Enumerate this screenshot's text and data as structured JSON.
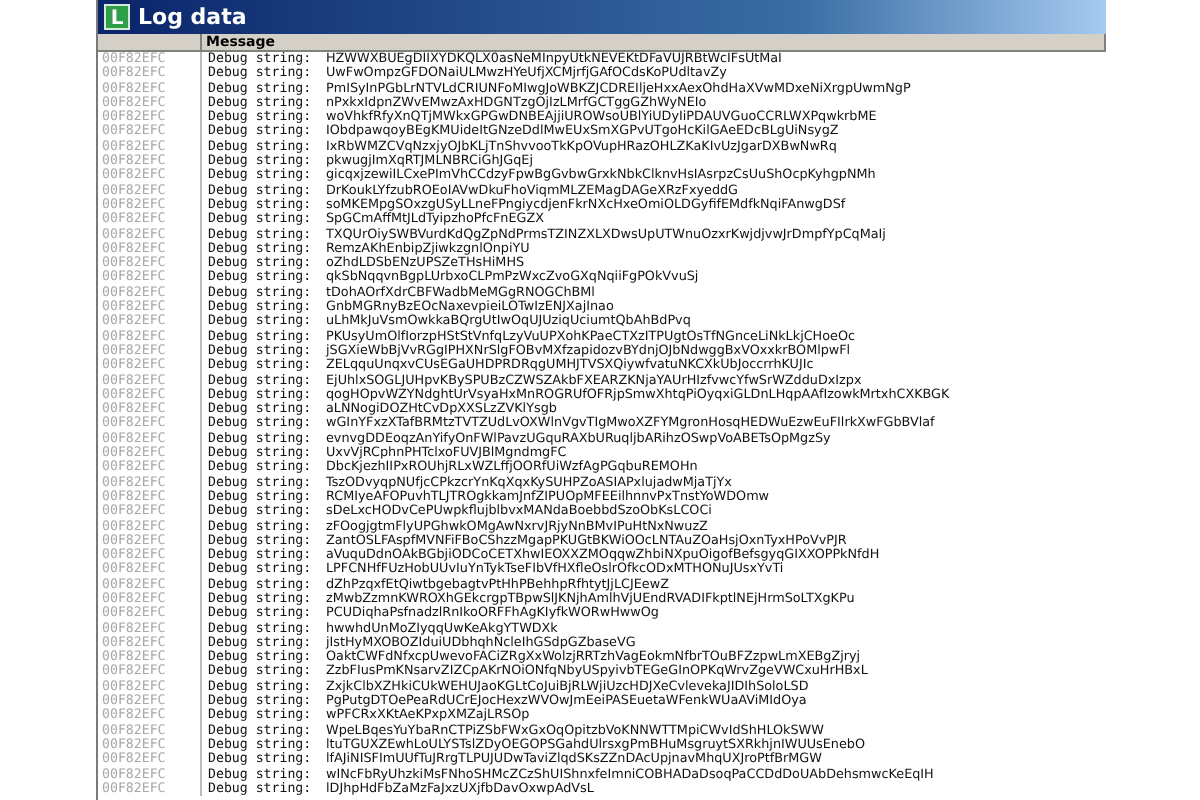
{
  "window": {
    "title": "Log data",
    "icon_letter": "L"
  },
  "columns": [
    "Message"
  ],
  "rows": [
    {
      "address": "00F82EFC",
      "type": "Debug string:",
      "message": "HZWWXBUEgDIIXYDKQLX0asNeMInpyUtkNEVEKtDFaVUJRBtWcIFsUtMaI"
    },
    {
      "address": "00F82EFC",
      "type": "Debug string:",
      "message": "UwFwOmpzGFDONaiULMwzHYeUfjXCMjrfjGAfOCdsKoPUdltavZy"
    },
    {
      "address": "00F82EFC",
      "type": "Debug string:",
      "message": "PmISyInPGbLrNTVLdCRIUNFoMIwgJoWBKZJCDREIljeHxxAexOhdHaXVwMDxeNiXrgpUwmNgP"
    },
    {
      "address": "00F82EFC",
      "type": "Debug string:",
      "message": "nPxkxIdpnZWvEMwzAxHDGNTzgOjIzLMrfGCTggGZhWyNEIo"
    },
    {
      "address": "00F82EFC",
      "type": "Debug string:",
      "message": "woVhkfRfyXnQTjMWkxGPGwDNBEAjjiUROWsoUBlYiUDyIiPDAUVGuoCCRLWXPqwkrbME"
    },
    {
      "address": "00F82EFC",
      "type": "Debug string:",
      "message": "IObdpawqoyBEgKMUideItGNzeDdlMwEUxSmXGPvUTgoHcKilGAeEDcBLgUiNsygZ"
    },
    {
      "address": "00F82EFC",
      "type": "Debug string:",
      "message": "IxRbWMZCVqNzxjyOJbKLjTnShvvooTkKpOVupHRazOHLZKaKIvUzJgarDXBwNwRq"
    },
    {
      "address": "00F82EFC",
      "type": "Debug string:",
      "message": "pkwugjImXqRTJMLNBRCiGhJGqEj"
    },
    {
      "address": "00F82EFC",
      "type": "Debug string:",
      "message": "gicqxjzewiILCxePImVhCCdzyFpwBgGvbwGrxkNbkClknvHsIAsrpzCsUuShOcpKyhgpNMh"
    },
    {
      "address": "00F82EFC",
      "type": "Debug string:",
      "message": "DrKoukLYfzubROEoIAVwDkuFhoViqmMLZEMagDAGeXRzFxyeddG"
    },
    {
      "address": "00F82EFC",
      "type": "Debug string:",
      "message": "soMKEMpgSOxzgUSyLLneFPngiycdjenFkrNXcHxeOmiOLDGyfifEMdfkNqiFAnwgDSf"
    },
    {
      "address": "00F82EFC",
      "type": "Debug string:",
      "message": "SpGCmAffMtJLdTyipzhoPfcFnEGZX"
    },
    {
      "address": "00F82EFC",
      "type": "Debug string:",
      "message": "TXQUrOiySWBVurdKdQgZpNdPrmsTZINZXLXDwsUpUTWnuOzxrKwjdjvwJrDmpfYpCqMaIj"
    },
    {
      "address": "00F82EFC",
      "type": "Debug string:",
      "message": "RemzAKhEnbipZjiwkzgnlOnpiYU"
    },
    {
      "address": "00F82EFC",
      "type": "Debug string:",
      "message": "oZhdLDSbENzUPSZeTHsHiMHS"
    },
    {
      "address": "00F82EFC",
      "type": "Debug string:",
      "message": "qkSbNqqvnBgpLUrbxoCLPmPzWxcZvoGXqNqiiFgPOkVvuSj"
    },
    {
      "address": "00F82EFC",
      "type": "Debug string:",
      "message": "tDohAOrfXdrCBFWadbMeMGgRNOGChBMl"
    },
    {
      "address": "00F82EFC",
      "type": "Debug string:",
      "message": "GnbMGRnyBzEOcNaxevpieiLOTwIzENJXajInao"
    },
    {
      "address": "00F82EFC",
      "type": "Debug string:",
      "message": "uLhMkJuVsmOwkkaBQrgUtIwOqUJUziqUciumtQbAhBdPvq"
    },
    {
      "address": "00F82EFC",
      "type": "Debug string:",
      "message": "PKUsyUmOlfIorzpHStStVnfqLzyVuUPXohKPaeCTXzITPUgtOsTfNGnceLiNkLkjCHoeOc"
    },
    {
      "address": "00F82EFC",
      "type": "Debug string:",
      "message": "jSGXieWbBjVvRGgIPHXNrSlgFOBvMXfzapidozvBYdnjOJbNdwggBxVOxxkrBOMlpwFl"
    },
    {
      "address": "00F82EFC",
      "type": "Debug string:",
      "message": "ZELqquUnqxvCUsEGaUHDPRDRqgUMHJTVSXQiywfvatuNKCXkUbJoccrrhKUJIc"
    },
    {
      "address": "00F82EFC",
      "type": "Debug string:",
      "message": "EjUhlxSOGLJUHpvKBySPUBzCZWSZAkbFXEARZKNjaYAUrHIzfvwcYfwSrWZdduDxIzpx"
    },
    {
      "address": "00F82EFC",
      "type": "Debug string:",
      "message": "qogHOpvWZYNdghtUrVsyaHxMnROGRUfOFRjpSmwXhtqPiOyqxiGLDnLHqpAAfIzowkMrtxhCXKBGK"
    },
    {
      "address": "00F82EFC",
      "type": "Debug string:",
      "message": "aLNNogiDOZHtCvDpXXSLzZVKlYsgb"
    },
    {
      "address": "00F82EFC",
      "type": "Debug string:",
      "message": "wGInYFxzXTafBRMtzTVTZUdLvOXWlnVgvTIgMwoXZFYMgronHosqHEDWuEzwEuFIlrkXwFGbBVlaf"
    },
    {
      "address": "00F82EFC",
      "type": "Debug string:",
      "message": "evnvgDDEoqzAnYifyOnFWlPavzUGquRAXbURuqljbARihzOSwpVoABETsOpMgzSy"
    },
    {
      "address": "00F82EFC",
      "type": "Debug string:",
      "message": "UxvVjRCphnPHTclxoFUVJBlMgndmgFC"
    },
    {
      "address": "00F82EFC",
      "type": "Debug string:",
      "message": "DbcKjezhIIPxROUhjRLxWZLffjOORfUiWzfAgPGqbuREMOHn"
    },
    {
      "address": "00F82EFC",
      "type": "Debug string:",
      "message": "TszODvyqpNUfjcCPkzcrYnKqXqxKySUHPZoASIAPxlujadwMjaTjYx"
    },
    {
      "address": "00F82EFC",
      "type": "Debug string:",
      "message": "RCMIyeAFOPuvhTLJTROgkkamJnfZIPUOpMFEEilhnnvPxTnstYoWDOmw"
    },
    {
      "address": "00F82EFC",
      "type": "Debug string:",
      "message": "sDeLxcHODvCePUwpkflujblbvxMANdaBoebbdSzoObKsLCOCi"
    },
    {
      "address": "00F82EFC",
      "type": "Debug string:",
      "message": "zFOogjgtmFlyUPGhwkOMgAwNxrvJRjyNnBMvIPuHtNxNwuzZ"
    },
    {
      "address": "00F82EFC",
      "type": "Debug string:",
      "message": "ZantOSLFAspfMVNFiFBoCShzzMgapPKUGtBKWiOOcLNTAuZOaHsjOxnTyxHPoVvPJR"
    },
    {
      "address": "00F82EFC",
      "type": "Debug string:",
      "message": "aVuquDdnOAkBGbjiODCoCETXhwIEOXXZMOqqwZhbiNXpuOigofBefsgyqGIXXOPPkNfdH"
    },
    {
      "address": "00F82EFC",
      "type": "Debug string:",
      "message": "LPFCNHfFUzHobUUvIuYnTykTseFIbVfHXfleOslrOfkcODxMTHONuJUsxYvTi"
    },
    {
      "address": "00F82EFC",
      "type": "Debug string:",
      "message": "dZhPzqxfEtQiwtbgebagtvPtHhPBehhpRfhtytJjLCJEewZ"
    },
    {
      "address": "00F82EFC",
      "type": "Debug string:",
      "message": "zMwbZzmnKWROXhGEkcrgpTBpwSlJKNjhAmlhVjUEndRVADIFkptlNEjHrmSoLTXgKPu"
    },
    {
      "address": "00F82EFC",
      "type": "Debug string:",
      "message": "PCUDiqhaPsfnadzlRnIkoORFFhAgKIyfkWORwHwwOg"
    },
    {
      "address": "00F82EFC",
      "type": "Debug string:",
      "message": "hwwhdUnMoZIyqqUwKeAkgYTWDXk"
    },
    {
      "address": "00F82EFC",
      "type": "Debug string:",
      "message": "jIstHyMXOBOZIduiUDbhqhNcleIhGSdpGZbaseVG"
    },
    {
      "address": "00F82EFC",
      "type": "Debug string:",
      "message": "OaktCWFdNfxcpUwevoFACiZRgXxWolzjRRTzhVagEokmNfbrTOuBFZzpwLmXEBgZjryj"
    },
    {
      "address": "00F82EFC",
      "type": "Debug string:",
      "message": "ZzbFIusPmKNsarvZIZCpAKrNOiONfqNbyUSpyivbTEGeGInOPKqWrvZgeVWCxuHrHBxL"
    },
    {
      "address": "00F82EFC",
      "type": "Debug string:",
      "message": "ZxjkClbXZHkiCUkWEHUJaoKGLtCoJuiBjRLWjiUzcHDJXeCvlevekaJIDIhSoloLSD"
    },
    {
      "address": "00F82EFC",
      "type": "Debug string:",
      "message": "PgPutgDTOePeaRdUCrEJocHexzWVOwJmEeiPASEuetaWFenkWUaAViMIdOya"
    },
    {
      "address": "00F82EFC",
      "type": "Debug string:",
      "message": "wPFCRxXKtAeKPxpXMZajLRSOp"
    },
    {
      "address": "00F82EFC",
      "type": "Debug string:",
      "message": "WpeLBqesYuYbaRnCTPiZSbFWxGxOqOpitzbVoKNNWTTMpiCWvIdShHLOkSWW"
    },
    {
      "address": "00F82EFC",
      "type": "Debug string:",
      "message": "ltuTGUXZEwhLoULYSTslZDyOEGOPSGahdUlrsxgPmBHuMsgruytSXRkhjnIWUUsEnebO"
    },
    {
      "address": "00F82EFC",
      "type": "Debug string:",
      "message": "lfAJiNISFImUUfTuJRrgTLPUJUDwTaviZlqdSKsZZnDAcUpjnavMhqUXJroPtfBrMGW"
    },
    {
      "address": "00F82EFC",
      "type": "Debug string:",
      "message": "wINcFbRyUhzkiMsFNhoSHMcZCzShUIShnxfeImniCOBHADaDsoqPaCCDdDoUAbDehsmwcKeEqIH"
    },
    {
      "address": "00F82EFC",
      "type": "Debug string:",
      "message": "lDJhpHdFbZaMzFaJxzUXjfbDavOxwpAdVsL"
    }
  ]
}
